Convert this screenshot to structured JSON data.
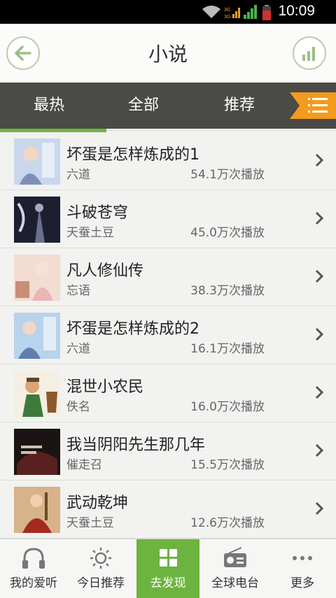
{
  "status_bar": {
    "time": "10:09",
    "signal1": "3G",
    "signal2": "3G"
  },
  "header": {
    "title": "小说",
    "back_icon": "back-arrow-icon",
    "chart_icon": "bar-chart-icon"
  },
  "tabs": [
    {
      "label": "最热",
      "active": true
    },
    {
      "label": "全部",
      "active": false
    },
    {
      "label": "推荐",
      "active": false
    }
  ],
  "accent_color": "#6db33f",
  "items": [
    {
      "title": "坏蛋是怎样炼成的1",
      "author": "六道",
      "plays": "54.1万次播放"
    },
    {
      "title": "斗破苍穹",
      "author": "天蚕土豆",
      "plays": "45.0万次播放"
    },
    {
      "title": "凡人修仙传",
      "author": "忘语",
      "plays": "38.3万次播放"
    },
    {
      "title": "坏蛋是怎样炼成的2",
      "author": "六道",
      "plays": "16.1万次播放"
    },
    {
      "title": "混世小农民",
      "author": "佚名",
      "plays": "16.0万次播放"
    },
    {
      "title": "我当阴阳先生那几年",
      "author": "催走召",
      "plays": "15.5万次播放"
    },
    {
      "title": "武动乾坤",
      "author": "天蚕土豆",
      "plays": "12.6万次播放"
    }
  ],
  "bottom_nav": [
    {
      "label": "我的爱听",
      "icon": "headphones-icon"
    },
    {
      "label": "今日推荐",
      "icon": "sun-icon"
    },
    {
      "label": "去发现",
      "icon": "grid-icon",
      "active": true
    },
    {
      "label": "全球电台",
      "icon": "radio-icon"
    },
    {
      "label": "更多",
      "icon": "more-dots-icon"
    }
  ]
}
